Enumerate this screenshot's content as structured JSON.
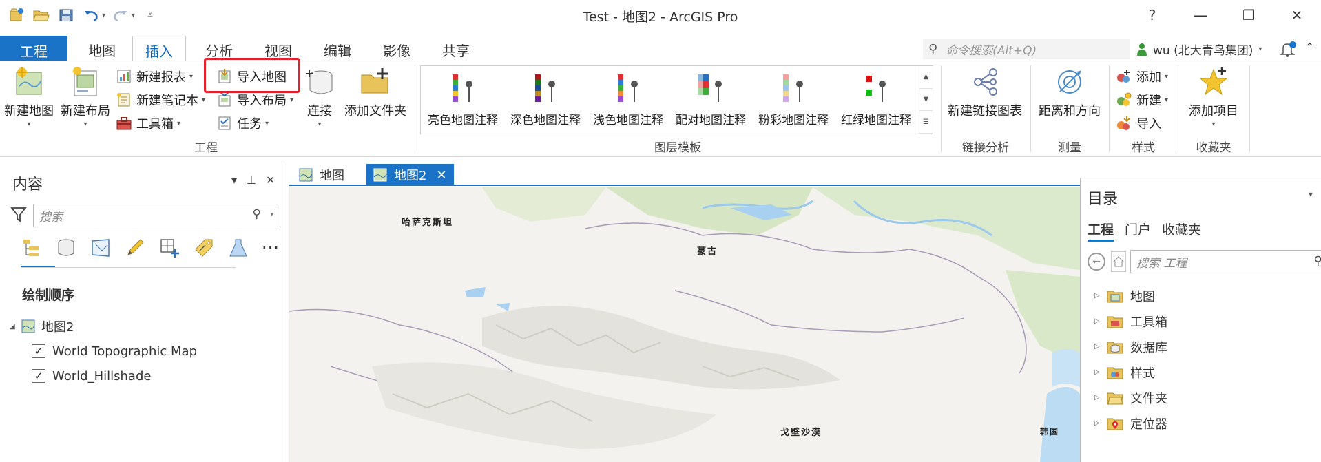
{
  "window": {
    "title": "Test - 地图2 - ArcGIS Pro",
    "help": "?",
    "minimize": "—",
    "maximize": "❐",
    "close": "✕"
  },
  "ribbon_tabs": [
    "工程",
    "地图",
    "插入",
    "分析",
    "视图",
    "编辑",
    "影像",
    "共享"
  ],
  "active_tab": "插入",
  "command_search": {
    "placeholder": "命令搜索(Alt+Q)"
  },
  "user": {
    "name": "wu (北大青鸟集团)"
  },
  "groups": {
    "project": {
      "label": "工程",
      "new_map": "新建地图",
      "new_layout": "新建布局",
      "new_report": "新建报表",
      "new_notebook": "新建笔记本",
      "toolbox": "工具箱",
      "import_map": "导入地图",
      "import_layout": "导入布局",
      "task": "任务",
      "connect": "连接",
      "add_folder": "添加文件夹"
    },
    "layer_templates": {
      "label": "图层模板",
      "items": [
        "亮色地图注释",
        "深色地图注释",
        "浅色地图注释",
        "配对地图注释",
        "粉彩地图注释",
        "红绿地图注释"
      ]
    },
    "link_analysis": {
      "label": "链接分析",
      "new_link_chart": "新建链接图表"
    },
    "measure": {
      "label": "测量",
      "distance_direction": "距离和方向"
    },
    "styles": {
      "label": "样式",
      "add": "添加",
      "new": "新建",
      "import": "导入"
    },
    "favorites": {
      "label": "收藏夹",
      "add_item": "添加项目"
    }
  },
  "contents": {
    "title": "内容",
    "search_placeholder": "搜索",
    "drawing_order": "绘制顺序",
    "map_name": "地图2",
    "layers": [
      "World Topographic Map",
      "World_Hillshade"
    ]
  },
  "map_tabs": [
    "地图",
    "地图2"
  ],
  "map_labels": {
    "kazakhstan": "哈萨克斯坦",
    "mongolia": "蒙古",
    "gobi": "戈壁沙漠",
    "korea": "韩国"
  },
  "catalog": {
    "title": "目录",
    "tabs": [
      "工程",
      "门户",
      "收藏夹"
    ],
    "search_placeholder": "搜索 工程",
    "items": [
      "地图",
      "工具箱",
      "数据库",
      "样式",
      "文件夹",
      "定位器"
    ]
  }
}
